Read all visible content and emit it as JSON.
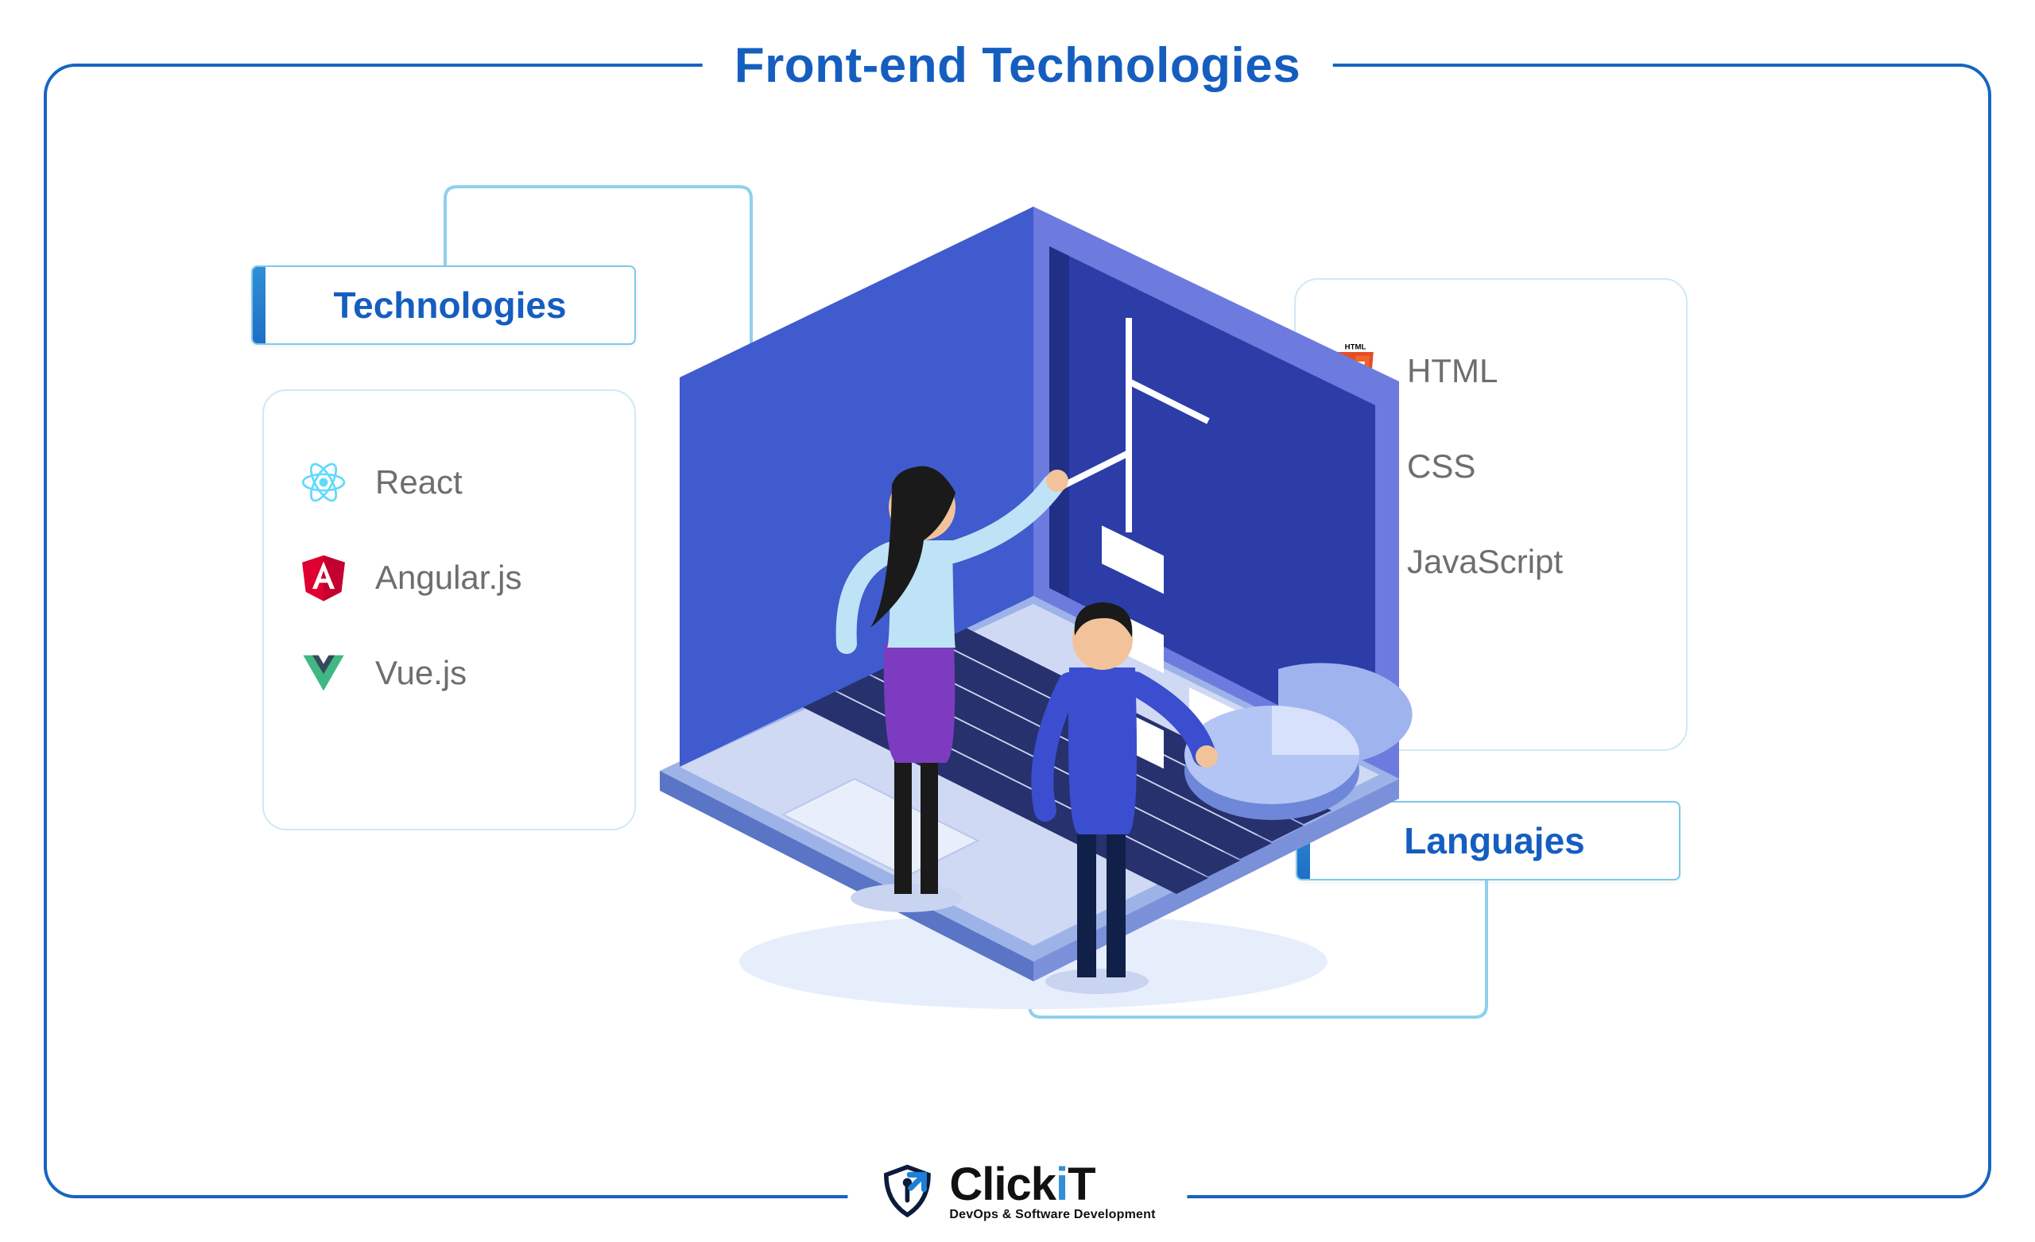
{
  "title": "Front-end Technologies",
  "groups": {
    "technologies": {
      "label": "Technologies",
      "items": [
        {
          "icon": "react-icon",
          "label": "React"
        },
        {
          "icon": "angular-icon",
          "label": "Angular.js"
        },
        {
          "icon": "vue-icon",
          "label": "Vue.js"
        }
      ]
    },
    "languages": {
      "label": "Languajes",
      "items": [
        {
          "icon": "html5-icon",
          "label": "HTML"
        },
        {
          "icon": "css3-icon",
          "label": "CSS"
        },
        {
          "icon": "js-icon",
          "label": "JavaScript"
        }
      ]
    }
  },
  "brand": {
    "name": "ClickIT",
    "tagline": "DevOps & Software Development"
  },
  "colors": {
    "primary": "#1565c0",
    "accent": "#5eb8e6"
  }
}
